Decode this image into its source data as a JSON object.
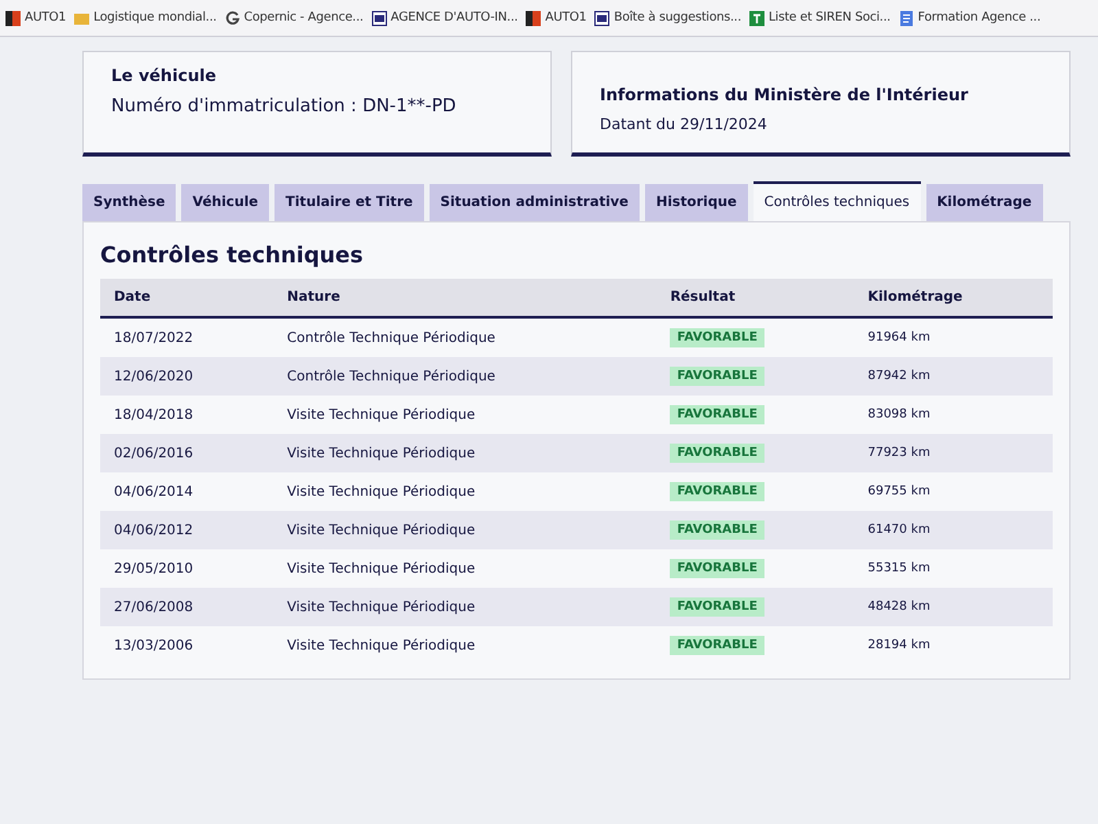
{
  "bookmarks": [
    {
      "label": "AUTO1",
      "kind": "flag"
    },
    {
      "label": "Logistique mondial...",
      "kind": "folder"
    },
    {
      "label": "Copernic - Agence...",
      "kind": "g"
    },
    {
      "label": "AGENCE D'AUTO-IN...",
      "kind": "page"
    },
    {
      "label": "AUTO1",
      "kind": "flag"
    },
    {
      "label": "Boîte à suggestions...",
      "kind": "page"
    },
    {
      "label": "Liste et SIREN Soci...",
      "kind": "sheet"
    },
    {
      "label": "Formation Agence ...",
      "kind": "doc"
    }
  ],
  "vehicle_card": {
    "title": "Le véhicule",
    "registration": "Numéro d'immatriculation : DN-1**-PD"
  },
  "ministry_card": {
    "title": "Informations du Ministère de l'Intérieur",
    "date": "Datant du 29/11/2024"
  },
  "tabs": [
    {
      "label": "Synthèse",
      "selected": false
    },
    {
      "label": "Véhicule",
      "selected": false
    },
    {
      "label": "Titulaire et Titre",
      "selected": false
    },
    {
      "label": "Situation administrative",
      "selected": false
    },
    {
      "label": "Historique",
      "selected": false
    },
    {
      "label": "Contrôles techniques",
      "selected": true
    },
    {
      "label": "Kilométrage",
      "selected": false
    }
  ],
  "section_title": "Contrôles techniques",
  "table": {
    "columns": [
      "Date",
      "Nature",
      "Résultat",
      "Kilométrage"
    ],
    "rows": [
      {
        "date": "18/07/2022",
        "nature": "Contrôle Technique Périodique",
        "result": "FAVORABLE",
        "mileage": "91964 km"
      },
      {
        "date": "12/06/2020",
        "nature": "Contrôle Technique Périodique",
        "result": "FAVORABLE",
        "mileage": "87942 km"
      },
      {
        "date": "18/04/2018",
        "nature": "Visite Technique Périodique",
        "result": "FAVORABLE",
        "mileage": "83098 km"
      },
      {
        "date": "02/06/2016",
        "nature": "Visite Technique Périodique",
        "result": "FAVORABLE",
        "mileage": "77923 km"
      },
      {
        "date": "04/06/2014",
        "nature": "Visite Technique Périodique",
        "result": "FAVORABLE",
        "mileage": "69755 km"
      },
      {
        "date": "04/06/2012",
        "nature": "Visite Technique Périodique",
        "result": "FAVORABLE",
        "mileage": "61470 km"
      },
      {
        "date": "29/05/2010",
        "nature": "Visite Technique Périodique",
        "result": "FAVORABLE",
        "mileage": "55315 km"
      },
      {
        "date": "27/06/2008",
        "nature": "Visite Technique Périodique",
        "result": "FAVORABLE",
        "mileage": "48428 km"
      },
      {
        "date": "13/03/2006",
        "nature": "Visite Technique Périodique",
        "result": "FAVORABLE",
        "mileage": "28194 km"
      }
    ]
  }
}
